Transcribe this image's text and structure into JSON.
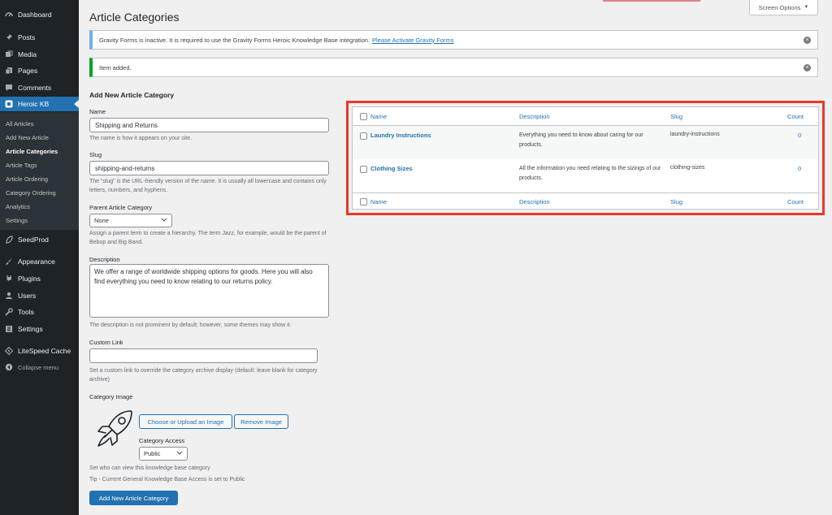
{
  "sidebar": {
    "menu": [
      {
        "label": "Dashboard",
        "icon": "dashboard-icon"
      },
      {
        "label": "Posts",
        "icon": "pin-icon"
      },
      {
        "label": "Media",
        "icon": "media-icon"
      },
      {
        "label": "Pages",
        "icon": "pages-icon"
      },
      {
        "label": "Comments",
        "icon": "comments-icon"
      },
      {
        "label": "Heroic KB",
        "icon": "heroic-kb-icon"
      }
    ],
    "submenu": [
      "All Articles",
      "Add New Article",
      "Article Categories",
      "Article Tags",
      "Article Ordering",
      "Category Ordering",
      "Analytics",
      "Settings"
    ],
    "menu2": [
      {
        "label": "SeedProd",
        "icon": "seedprod-icon"
      },
      {
        "label": "Appearance",
        "icon": "brush-icon"
      },
      {
        "label": "Plugins",
        "icon": "plug-icon"
      },
      {
        "label": "Users",
        "icon": "user-icon"
      },
      {
        "label": "Tools",
        "icon": "wrench-icon"
      },
      {
        "label": "Settings",
        "icon": "settings-icon"
      },
      {
        "label": "LiteSpeed Cache",
        "icon": "litespeed-icon"
      },
      {
        "label": "Collapse menu",
        "icon": "collapse-icon"
      }
    ]
  },
  "header": {
    "title": "Article Categories",
    "screen_options": "Screen Options"
  },
  "notices": {
    "gravity_text": "Gravity Forms is inactive. It is required to use the Gravity Forms Heroic Knowledge Base integration.",
    "gravity_link": "Please Activate Gravity Forms",
    "item_added": "Item added."
  },
  "form": {
    "heading": "Add New Article Category",
    "name_label": "Name",
    "name_value": "Shipping and Returns",
    "name_help": "The name is how it appears on your site.",
    "slug_label": "Slug",
    "slug_value": "shipping-and-returns",
    "slug_help": "The “slug” is the URL-friendly version of the name. It is usually all lowercase and contains only letters, numbers, and hyphens.",
    "parent_label": "Parent Article Category",
    "parent_value": "None",
    "parent_help": "Assign a parent term to create a hierarchy. The term Jazz, for example, would be the parent of Bebop and Big Band.",
    "desc_label": "Description",
    "desc_value": "We offer a range of worldwide shipping options for goods. Here you will also find everything you need to know relating to our returns policy.",
    "desc_help": "The description is not prominent by default; however, some themes may show it.",
    "link_label": "Custom Link",
    "link_value": "",
    "link_help": "Set a custom link to override the category archive display (default: leave blank for category archive)",
    "image_label": "Category Image",
    "upload_button": "Choose or Upload an Image",
    "remove_button": "Remove Image",
    "access_label": "Category Access",
    "access_value": "Public",
    "access_help": "Set who can view this knowledge base category",
    "tip": "Tip - Current General Knowledge Base Access is set to Public",
    "submit": "Add New Article Category"
  },
  "table": {
    "columns": {
      "name": "Name",
      "description": "Description",
      "slug": "Slug",
      "count": "Count"
    },
    "rows": [
      {
        "name": "Laundry Instructions",
        "description": "Everything you need to know about caring for our products.",
        "slug": "laundry-instructions",
        "count": "0"
      },
      {
        "name": "Clothing Sizes",
        "description": "All the information you need relating to the sizings of our products.",
        "slug": "clothing-sizes",
        "count": "0"
      }
    ]
  },
  "colors": {
    "accent": "#2271b1",
    "sidebar": "#1d2327",
    "highlight": "#e8392a",
    "success": "#00a32a"
  }
}
